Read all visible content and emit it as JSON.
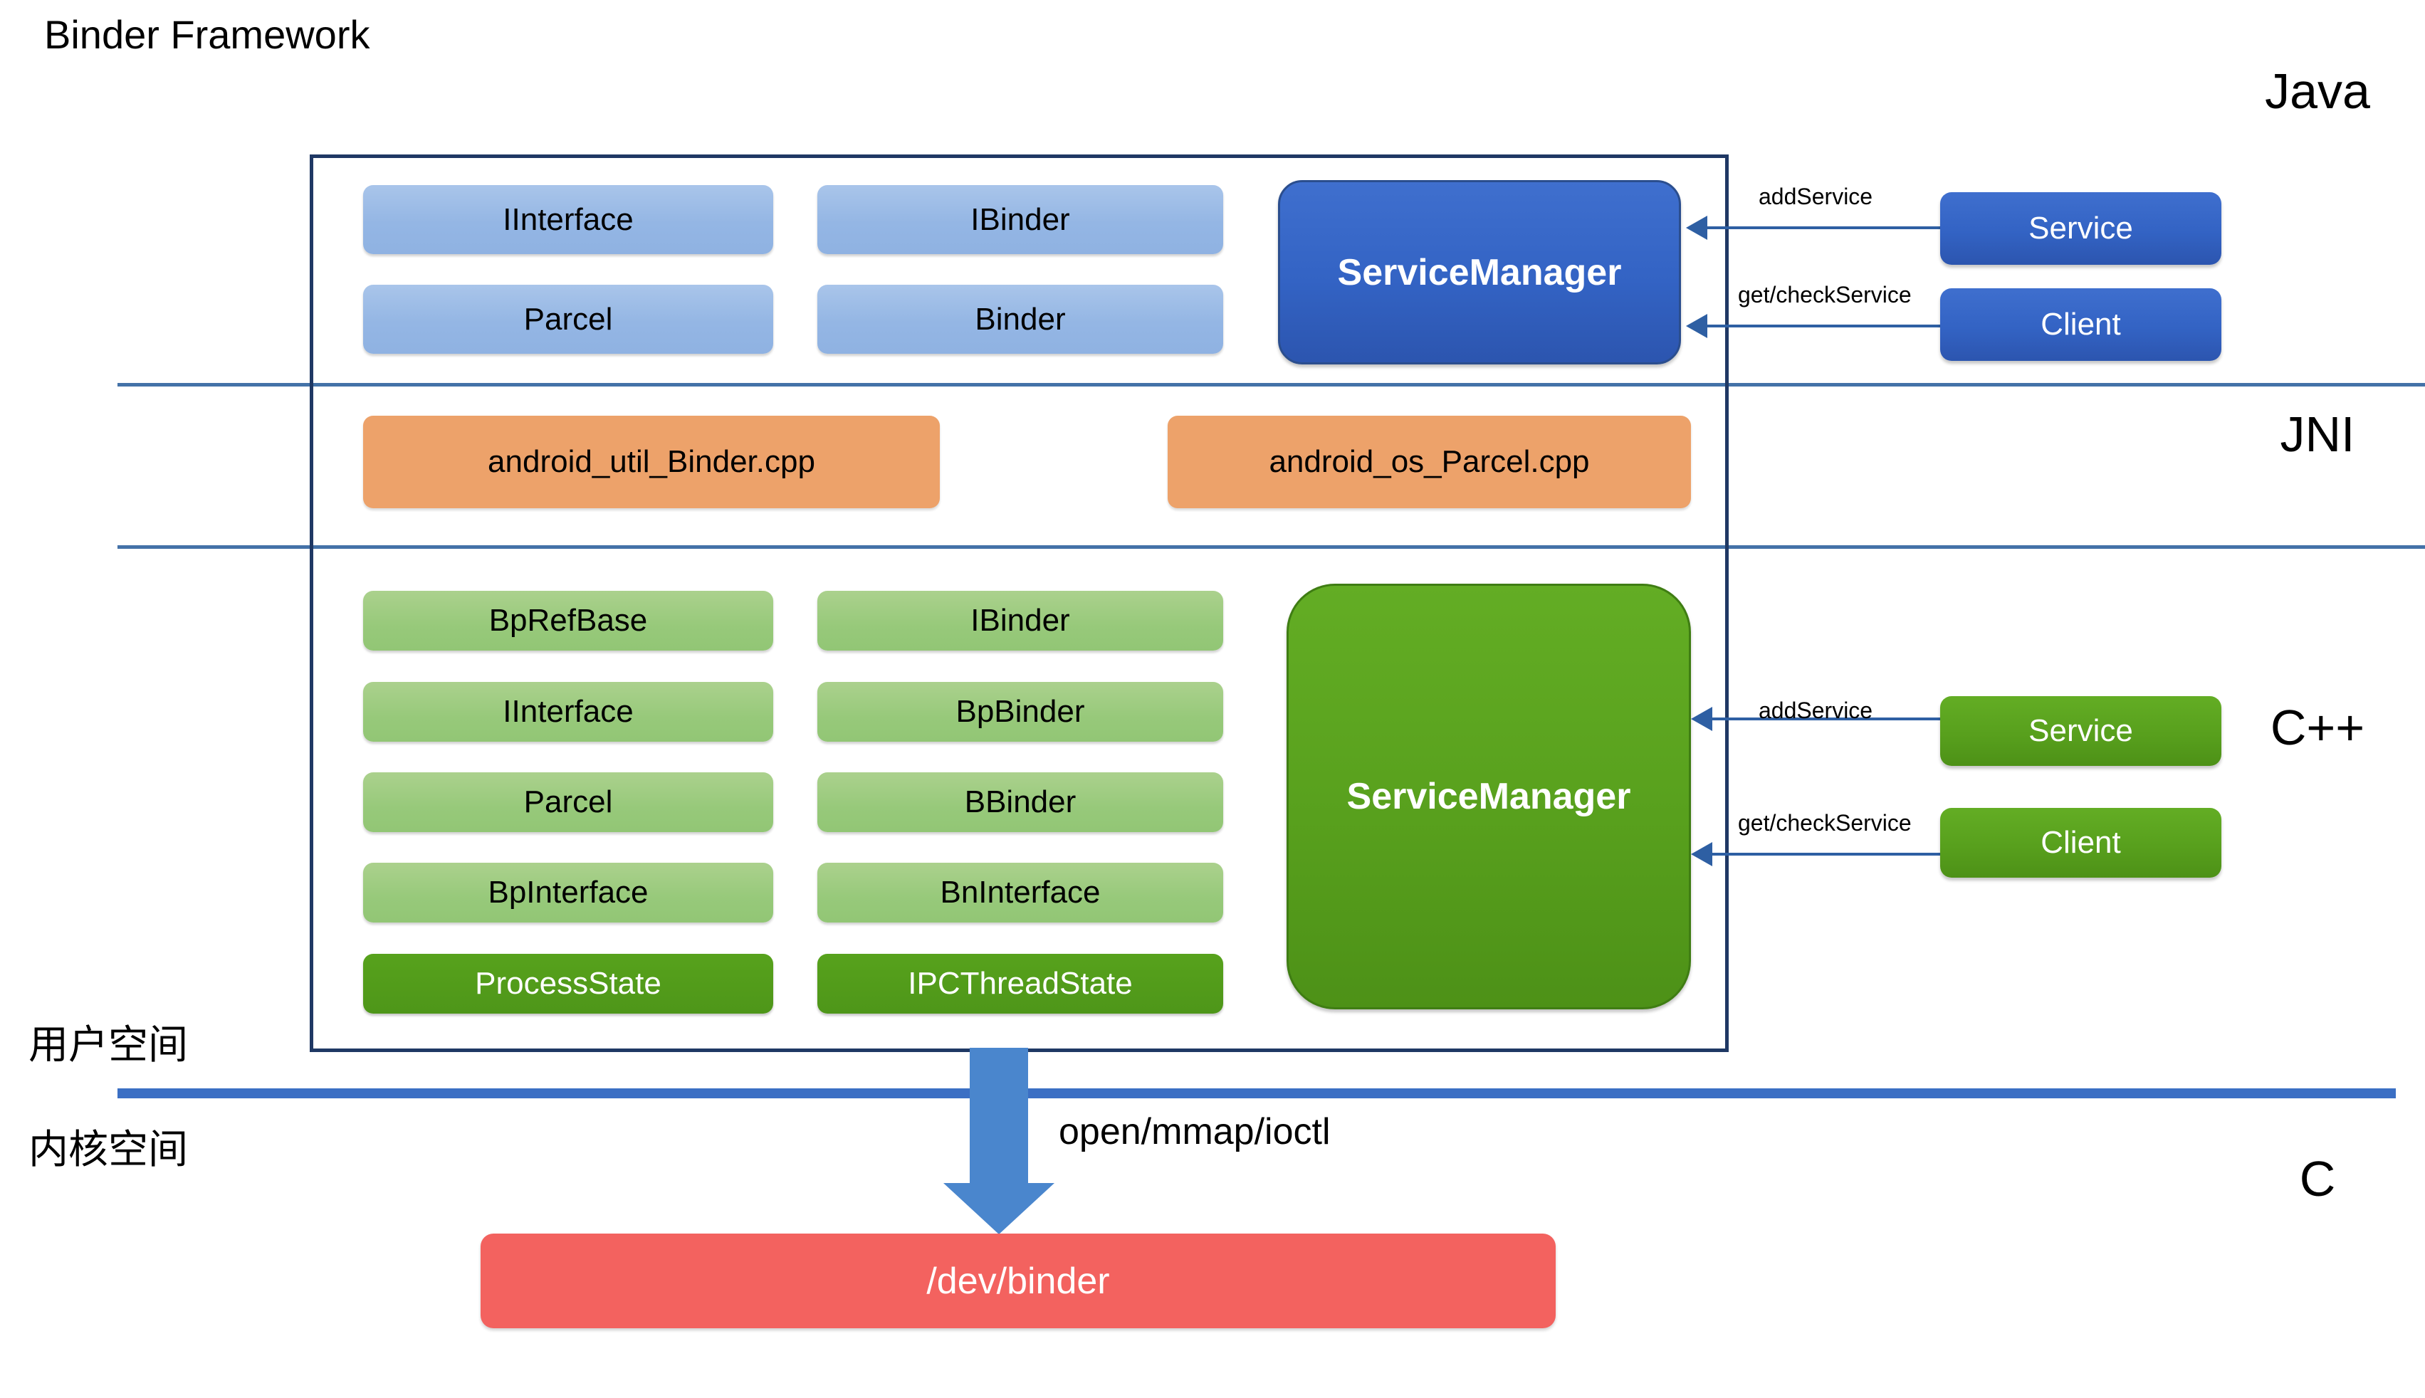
{
  "title": "Binder Framework",
  "layers": [
    {
      "label": "Java"
    },
    {
      "label": "JNI"
    },
    {
      "label": "C++"
    },
    {
      "label": "C"
    }
  ],
  "java_layer": {
    "column_left": [
      {
        "label": "IInterface"
      },
      {
        "label": "Parcel"
      }
    ],
    "column_right": [
      {
        "label": "IBinder"
      },
      {
        "label": "Binder"
      }
    ],
    "service_manager": {
      "label": "ServiceManager"
    },
    "callers": [
      {
        "label": "Service",
        "edge_label": "addService"
      },
      {
        "label": "Client",
        "edge_label": "get/checkService"
      }
    ]
  },
  "jni_layer": {
    "files": [
      {
        "label": "android_util_Binder.cpp"
      },
      {
        "label": "android_os_Parcel.cpp"
      }
    ]
  },
  "cpp_layer": {
    "column_left": [
      {
        "label": "BpRefBase",
        "style": "light"
      },
      {
        "label": "IInterface",
        "style": "light"
      },
      {
        "label": "Parcel",
        "style": "light"
      },
      {
        "label": "BpInterface",
        "style": "light"
      },
      {
        "label": "ProcessState",
        "style": "dark"
      }
    ],
    "column_right": [
      {
        "label": "IBinder",
        "style": "light"
      },
      {
        "label": "BpBinder",
        "style": "light"
      },
      {
        "label": "BBinder",
        "style": "light"
      },
      {
        "label": "BnInterface",
        "style": "light"
      },
      {
        "label": "IPCThreadState",
        "style": "dark"
      }
    ],
    "service_manager": {
      "label": "ServiceManager"
    },
    "callers": [
      {
        "label": "Service",
        "edge_label": "addService"
      },
      {
        "label": "Client",
        "edge_label": "get/checkService"
      }
    ]
  },
  "space_labels": {
    "user": "用户空间",
    "kernel": "内核空间"
  },
  "kernel_layer": {
    "syscall_label": "open/mmap/ioctl",
    "device": "/dev/binder"
  },
  "colors": {
    "container_border": "#1f3864",
    "divider_thin": "#4472a8",
    "divider_thick": "#3b6fc4",
    "java_box": "#94b6e4",
    "java_service_manager": "#3363c4",
    "jni_box": "#eda26a",
    "cpp_box": "#97c97a",
    "cpp_box_dark": "#4e9619",
    "cpp_service_manager": "#58a01d",
    "arrow": "#2e5fa3",
    "down_arrow": "#4a86cd",
    "device_box": "#f3625f"
  }
}
